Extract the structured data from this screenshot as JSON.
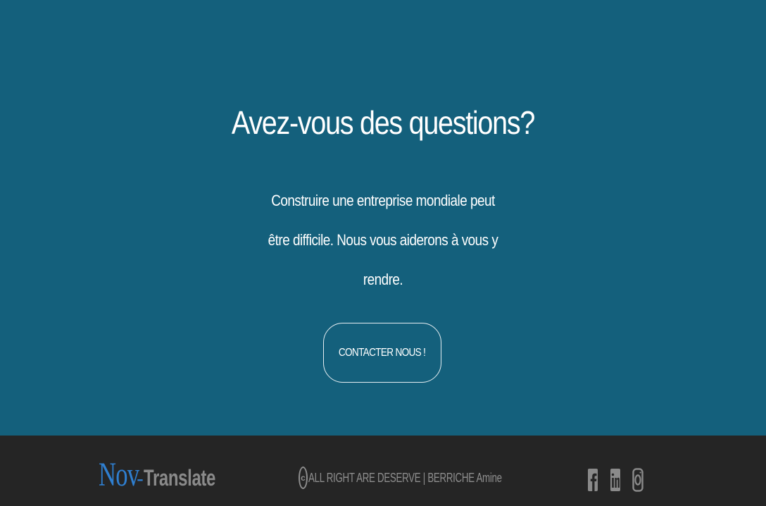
{
  "cta": {
    "title": "Avez-vous des questions?",
    "text": "Construire une entreprise mondiale peut être difficile. Nous vous aiderons à vous y rendre.",
    "button_label": "CONTACTER NOUS !"
  },
  "footer": {
    "brand": {
      "part1": "Nov",
      "separator": "-",
      "part2": "Translate"
    },
    "copyright_symbol": "c",
    "copyright_text": "ALL RIGHT ARE DESERVE | BERRICHE Amine",
    "social_icons": [
      "facebook-icon",
      "linkedin-icon",
      "instagram-icon"
    ]
  },
  "colors": {
    "cta_background": "#14607c",
    "footer_background": "#252525",
    "brand_accent": "#2f7fd0",
    "footer_text": "#8e8e8e"
  }
}
